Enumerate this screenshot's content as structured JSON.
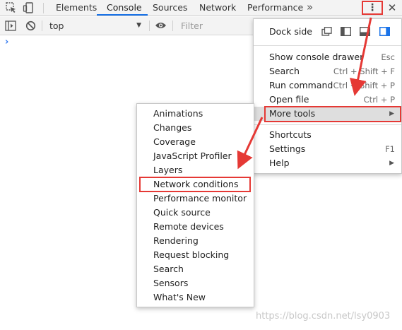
{
  "tabs": [
    {
      "label": "Elements",
      "active": false
    },
    {
      "label": "Console",
      "active": true
    },
    {
      "label": "Sources",
      "active": false
    },
    {
      "label": "Network",
      "active": false
    },
    {
      "label": "Performance",
      "active": false
    }
  ],
  "more_tabs_glyph": "»",
  "kebab_glyph": "⋮",
  "close_glyph": "✕",
  "toolbar": {
    "context": "top",
    "filter_placeholder": "Filter"
  },
  "console_prompt": "›",
  "main_menu": {
    "dock_label": "Dock side",
    "items_group1": [
      {
        "label": "Show console drawer",
        "shortcut": "Esc"
      },
      {
        "label": "Search",
        "shortcut": "Ctrl + Shift + F"
      },
      {
        "label": "Run command",
        "shortcut": "Ctrl + Shift + P"
      },
      {
        "label": "Open file",
        "shortcut": "Ctrl + P"
      },
      {
        "label": "More tools",
        "shortcut": ""
      }
    ],
    "items_group2": [
      {
        "label": "Shortcuts",
        "shortcut": ""
      },
      {
        "label": "Settings",
        "shortcut": "F1"
      },
      {
        "label": "Help",
        "shortcut": ""
      }
    ]
  },
  "submenu_items": [
    "Animations",
    "Changes",
    "Coverage",
    "JavaScript Profiler",
    "Layers",
    "Network conditions",
    "Performance monitor",
    "Quick source",
    "Remote devices",
    "Rendering",
    "Request blocking",
    "Search",
    "Sensors",
    "What's New"
  ],
  "watermark": "https://blog.csdn.net/lsy0903",
  "colors": {
    "accent": "#1a73e8",
    "highlight_box": "#e53935",
    "prompt": "#367cf1"
  }
}
